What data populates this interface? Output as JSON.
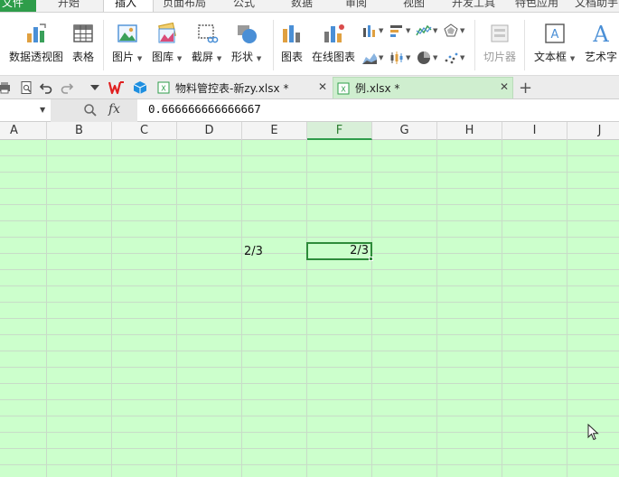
{
  "menu_tabs": [
    "文件",
    "开始",
    "插入",
    "页面布局",
    "公式",
    "数据",
    "审阅",
    "视图",
    "开发工具",
    "特色应用",
    "文档助手"
  ],
  "ribbon": {
    "pivot_label": "数据透视图",
    "table_label": "表格",
    "picture_label": "图片",
    "gallery_label": "图库",
    "screenshot_label": "截屏",
    "shapes_label": "形状",
    "chart_label": "图表",
    "online_chart_label": "在线图表",
    "slicer_label": "切片器",
    "textbox_label": "文本框",
    "wordart_label": "艺术字"
  },
  "doc_tabs": [
    {
      "label": "物料管控表-新zy.xlsx *"
    },
    {
      "label": "例.xlsx *"
    }
  ],
  "formula_bar": {
    "name_box": "",
    "fx": "fx",
    "value": "0.666666666666667"
  },
  "columns": [
    "A",
    "B",
    "C",
    "D",
    "E",
    "F",
    "G",
    "H",
    "I",
    "J"
  ],
  "selected_column": "F",
  "cells": {
    "E7": "2/3",
    "F7": "2/3"
  },
  "colors": {
    "grid_bg": "#ccffcc",
    "accent": "#2e9d4a",
    "wps_red": "#e02020"
  }
}
